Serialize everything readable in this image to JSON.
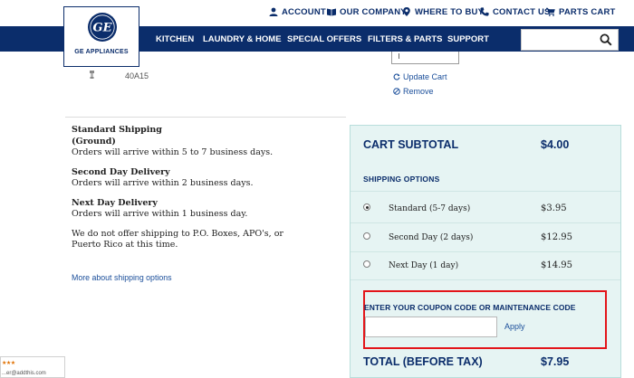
{
  "header": {
    "links": [
      {
        "label": "ACCOUNT",
        "icon": "user-icon"
      },
      {
        "label": "OUR COMPANY",
        "icon": "book-icon"
      },
      {
        "label": "WHERE TO BUY",
        "icon": "map-pin-icon"
      },
      {
        "label": "CONTACT US",
        "icon": "phone-icon"
      },
      {
        "label": "PARTS CART",
        "icon": "cart-icon"
      }
    ],
    "logo_text": "GE APPLIANCES",
    "logo_glyph": "GE"
  },
  "nav": {
    "items": [
      "KITCHEN",
      "LAUNDRY & HOME",
      "SPECIAL OFFERS",
      "FILTERS & PARTS",
      "SUPPORT"
    ],
    "search_placeholder": "",
    "search_icon": "search-icon"
  },
  "cart_item": {
    "sku": "40A15",
    "update_label": "Update Cart",
    "remove_label": "Remove"
  },
  "shipping_info": {
    "blocks": [
      {
        "title": "Standard Shipping",
        "subtitle": "(Ground)",
        "desc": "Orders will arrive within 5 to 7 business days."
      },
      {
        "title": "Second Day Delivery",
        "desc": "Orders will arrive within 2 business days."
      },
      {
        "title": "Next Day Delivery",
        "desc": "Orders will arrive within 1 business day."
      }
    ],
    "note": "We do not offer shipping to P.O. Boxes, APO's, or Puerto Rico at this time.",
    "more_link": "More about shipping options"
  },
  "summary": {
    "subtotal_label": "CART SUBTOTAL",
    "subtotal_value": "$4.00",
    "options_heading": "SHIPPING OPTIONS",
    "options": [
      {
        "label": "Standard (5-7 days)",
        "price": "$3.95",
        "selected": true
      },
      {
        "label": "Second Day (2 days)",
        "price": "$12.95",
        "selected": false
      },
      {
        "label": "Next Day (1 day)",
        "price": "$14.95",
        "selected": false
      }
    ],
    "coupon_label": "ENTER YOUR COUPON CODE OR MAINTENANCE CODE",
    "coupon_value": "",
    "apply_label": "Apply",
    "total_label": "TOTAL (BEFORE TAX)",
    "total_value": "$7.95"
  },
  "reviews_widget": {
    "stars": "★★★",
    "text": "...er@addthis.com"
  },
  "colors": {
    "brand_navy": "#0b2d6b",
    "panel_bg": "#e6f4f3",
    "highlight_red": "#e3151a",
    "link_blue": "#1a4e9a"
  }
}
